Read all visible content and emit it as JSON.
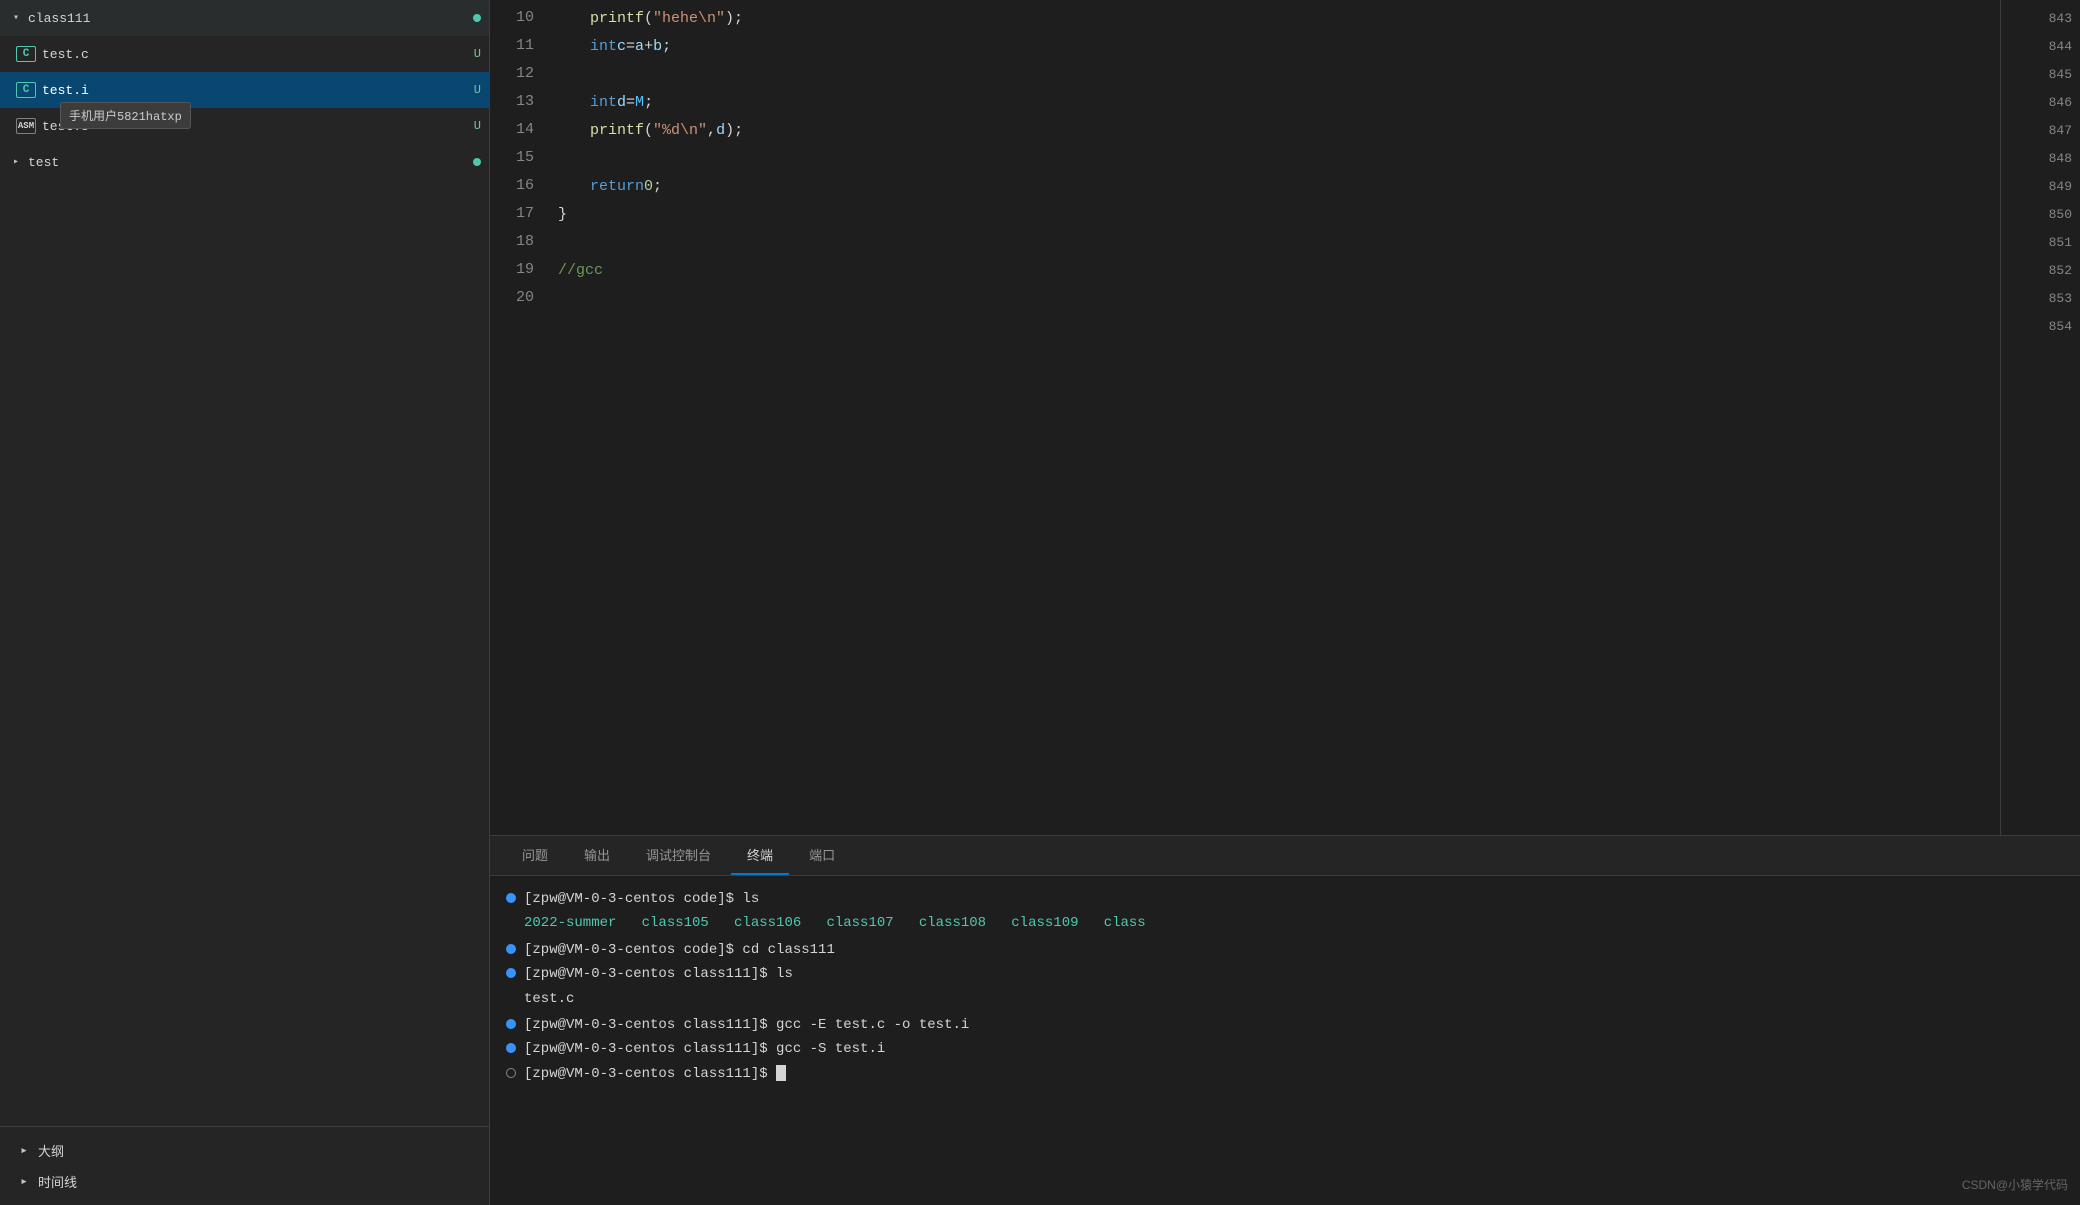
{
  "sidebar": {
    "folder": {
      "name": "class111",
      "expanded": true,
      "dot_color": "green"
    },
    "files": [
      {
        "icon": "C",
        "icon_type": "c-icon",
        "label": "test.c",
        "badge": "U",
        "active": false
      },
      {
        "icon": "C",
        "icon_type": "c-icon",
        "label": "test.i",
        "badge": "U",
        "active": true
      },
      {
        "icon": "ASM",
        "icon_type": "asm-icon",
        "label": "test.s",
        "badge": "U",
        "active": false
      }
    ],
    "tooltip": "手机用户5821hatxp",
    "sub_folder": {
      "name": "test",
      "dot_color": "green"
    },
    "bottom_items": [
      {
        "label": "大纲"
      },
      {
        "label": "时间线"
      }
    ]
  },
  "editor": {
    "lines": [
      {
        "num": 10,
        "code": "printf(\"hehe\\n\");",
        "minimap": 843
      },
      {
        "num": 11,
        "code": "int c = a + b;",
        "minimap": 844
      },
      {
        "num": 12,
        "code": "",
        "minimap": 845
      },
      {
        "num": 13,
        "code": "int d = M;",
        "minimap": 846
      },
      {
        "num": 14,
        "code": "printf(\"%d\\n\", d);",
        "minimap": 847
      },
      {
        "num": 15,
        "code": "",
        "minimap": 848
      },
      {
        "num": 16,
        "code": "return 0;",
        "minimap": 849
      },
      {
        "num": 17,
        "code": "}",
        "minimap": 850
      },
      {
        "num": 18,
        "code": "",
        "minimap": 851
      },
      {
        "num": 19,
        "code": "//gcc",
        "minimap": 852
      },
      {
        "num": 20,
        "code": "",
        "minimap": 853
      },
      {
        "num": "",
        "code": "",
        "minimap": 854
      }
    ]
  },
  "panel": {
    "tabs": [
      {
        "label": "问题",
        "active": false
      },
      {
        "label": "输出",
        "active": false
      },
      {
        "label": "调试控制台",
        "active": false
      },
      {
        "label": "终端",
        "active": true
      },
      {
        "label": "端口",
        "active": false
      }
    ],
    "terminal_lines": [
      {
        "dot": "solid",
        "prompt": "[zpw@VM-0-3-centos code]$ ls",
        "output": "2022-summer  class105  class106  class107  class108  class109  class"
      },
      {
        "dot": "solid",
        "prompt": "[zpw@VM-0-3-centos code]$ cd class111",
        "output": null
      },
      {
        "dot": "solid",
        "prompt": "[zpw@VM-0-3-centos class111]$ ls",
        "output": "test.c"
      },
      {
        "dot": "solid",
        "prompt": "[zpw@VM-0-3-centos class111]$ gcc -E test.c -o test.i",
        "output": null
      },
      {
        "dot": "solid",
        "prompt": "[zpw@VM-0-3-centos class111]$ gcc -S test.i",
        "output": null
      },
      {
        "dot": "hollow",
        "prompt": "[zpw@VM-0-3-centos class111]$ ",
        "output": null,
        "cursor": true
      }
    ]
  },
  "watermark": "CSDN@小猿学代码"
}
